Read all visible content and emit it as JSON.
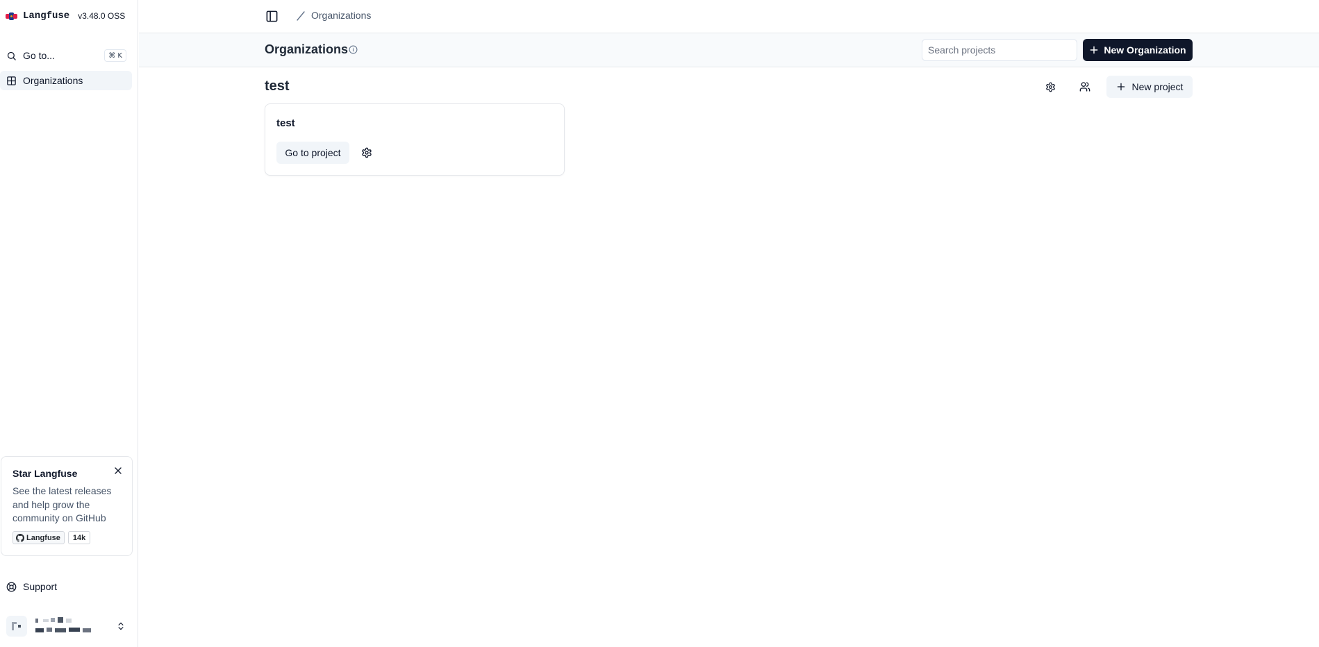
{
  "app": {
    "name": "Langfuse",
    "version": "v3.48.0 OSS",
    "brand_colors": [
      "#e11d48",
      "#1e3a8a",
      "#f59e0b"
    ]
  },
  "sidebar": {
    "goto_label": "Go to...",
    "goto_shortcut": "⌘ K",
    "items": [
      {
        "label": "Organizations",
        "icon": "grid-icon",
        "active": true
      }
    ],
    "star_card": {
      "title": "Star Langfuse",
      "text": "See the latest releases and help grow the community on GitHub",
      "github_label": "Langfuse",
      "github_count": "14k"
    },
    "support_label": "Support"
  },
  "topbar": {
    "breadcrumb": "Organizations"
  },
  "header": {
    "title": "Organizations",
    "search_placeholder": "Search projects",
    "new_org_label": "New Organization"
  },
  "org": {
    "name": "test",
    "new_project_label": "New project",
    "projects": [
      {
        "name": "test",
        "goto_label": "Go to project"
      }
    ]
  },
  "colors": {
    "primary": "#0f172a",
    "muted_bg": "#f1f5f9",
    "border": "#e5e7eb",
    "header_bg": "#f8fafc"
  }
}
